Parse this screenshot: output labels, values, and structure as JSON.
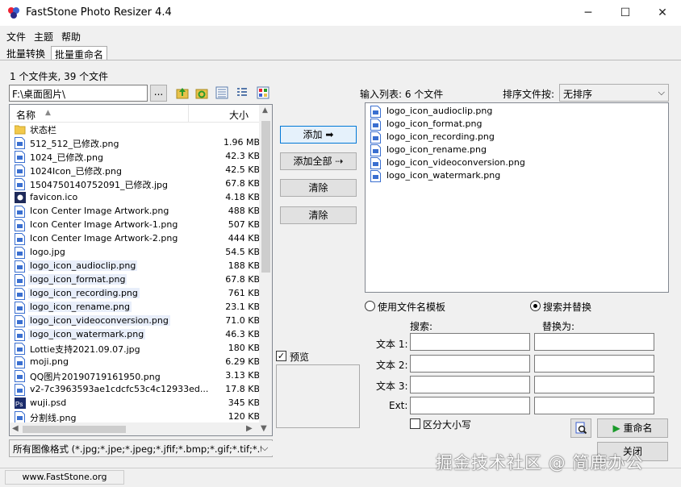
{
  "window": {
    "title": "FastStone Photo Resizer 4.4",
    "minimize": "─",
    "maximize": "☐",
    "close": "✕"
  },
  "menu": [
    "文件",
    "主题",
    "帮助"
  ],
  "tabs": [
    "批量转换",
    "批量重命名"
  ],
  "summary": "1 个文件夹, 39 个文件",
  "path": "F:\\桌面图片\\",
  "browse_label": "...",
  "file_list": {
    "col_name": "名称",
    "col_size": "大小",
    "items": [
      {
        "name": "状态栏",
        "size": "",
        "type": "folder"
      },
      {
        "name": "512_512_已修改.png",
        "size": "1.96 MB",
        "type": "png"
      },
      {
        "name": "1024_已修改.png",
        "size": "42.3 KB",
        "type": "png"
      },
      {
        "name": "1024Icon_已修改.png",
        "size": "42.5 KB",
        "type": "png"
      },
      {
        "name": "1504750140752091_已修改.jpg",
        "size": "67.8 KB",
        "type": "png"
      },
      {
        "name": "favicon.ico",
        "size": "4.18 KB",
        "type": "ico"
      },
      {
        "name": "Icon Center Image Artwork.png",
        "size": "488 KB",
        "type": "png"
      },
      {
        "name": "Icon Center Image Artwork-1.png",
        "size": "507 KB",
        "type": "png"
      },
      {
        "name": "Icon Center Image Artwork-2.png",
        "size": "444 KB",
        "type": "png"
      },
      {
        "name": "logo.jpg",
        "size": "54.5 KB",
        "type": "png"
      },
      {
        "name": "logo_icon_audioclip.png",
        "size": "188 KB",
        "type": "png",
        "sel": true
      },
      {
        "name": "logo_icon_format.png",
        "size": "67.8 KB",
        "type": "png",
        "sel": true
      },
      {
        "name": "logo_icon_recording.png",
        "size": "761 KB",
        "type": "png",
        "sel": true
      },
      {
        "name": "logo_icon_rename.png",
        "size": "23.1 KB",
        "type": "png",
        "sel": true
      },
      {
        "name": "logo_icon_videoconversion.png",
        "size": "71.0 KB",
        "type": "png",
        "sel": true
      },
      {
        "name": "logo_icon_watermark.png",
        "size": "46.3 KB",
        "type": "png",
        "sel": true
      },
      {
        "name": "Lottie支持2021.09.07.jpg",
        "size": "180 KB",
        "type": "png"
      },
      {
        "name": "moji.png",
        "size": "6.29 KB",
        "type": "png"
      },
      {
        "name": "QQ图片20190719161950.png",
        "size": "3.13 KB",
        "type": "png"
      },
      {
        "name": "v2-7c3963593ae1cdcfc53c4c12933ed...",
        "size": "17.8 KB",
        "type": "png"
      },
      {
        "name": "wuji.psd",
        "size": "345 KB",
        "type": "psd"
      },
      {
        "name": "分割线.png",
        "size": "120 KB",
        "type": "png"
      }
    ]
  },
  "filter": "所有图像格式 (*.jpg;*.jpe;*.jpeg;*.jfif;*.bmp;*.gif;*.tif;*.tif",
  "buttons": {
    "add": "添加",
    "add_all": "添加全部",
    "clear": "清除",
    "clear_all": "清除",
    "rename": "重命名",
    "close": "关闭"
  },
  "preview_label": "预览",
  "input_list": {
    "label": "输入列表: 6 个文件",
    "sort_label": "排序文件按:",
    "sort_value": "无排序",
    "items": [
      "logo_icon_audioclip.png",
      "logo_icon_format.png",
      "logo_icon_recording.png",
      "logo_icon_rename.png",
      "logo_icon_videoconversion.png",
      "logo_icon_watermark.png"
    ]
  },
  "options": {
    "template": "使用文件名模板",
    "search_replace": "搜索并替换",
    "search_header": "搜索:",
    "replace_header": "替换为:",
    "rows": [
      "文本 1:",
      "文本 2:",
      "文本 3:",
      "Ext:"
    ],
    "case_sensitive": "区分大小写"
  },
  "status": "www.FastStone.org",
  "watermark": "掘金技术社区 @ 简鹿办公"
}
